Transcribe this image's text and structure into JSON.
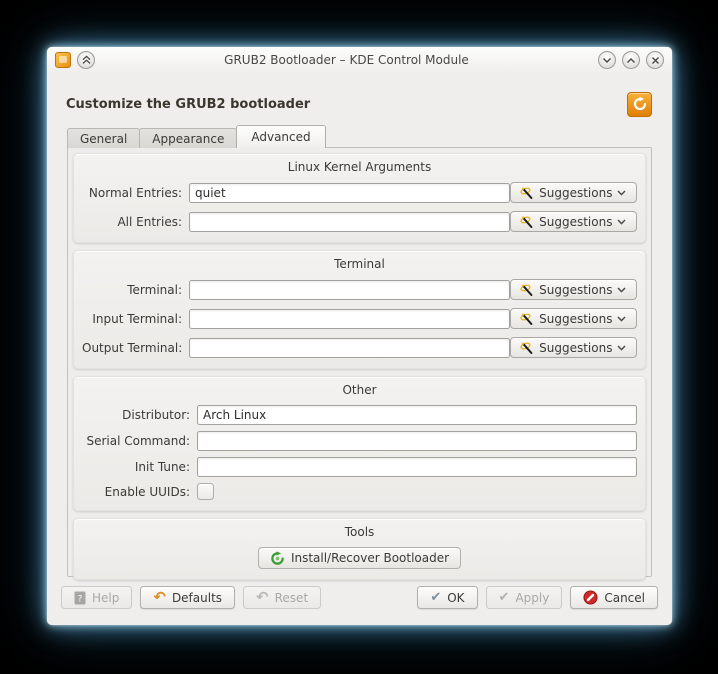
{
  "titlebar": {
    "title": "GRUB2 Bootloader – KDE Control Module"
  },
  "header": {
    "title": "Customize the GRUB2 bootloader"
  },
  "tabs": {
    "general": "General",
    "appearance": "Appearance",
    "advanced": "Advanced"
  },
  "labels": {
    "suggestions": "Suggestions"
  },
  "kernel": {
    "title": "Linux Kernel Arguments",
    "normal_label": "Normal Entries:",
    "normal_value": "quiet",
    "all_label": "All Entries:",
    "all_value": ""
  },
  "terminal": {
    "title": "Terminal",
    "terminal_label": "Terminal:",
    "terminal_value": "",
    "input_label": "Input Terminal:",
    "input_value": "",
    "output_label": "Output Terminal:",
    "output_value": ""
  },
  "other": {
    "title": "Other",
    "distributor_label": "Distributor:",
    "distributor_value": "Arch Linux",
    "serial_label": "Serial Command:",
    "serial_value": "",
    "init_label": "Init Tune:",
    "init_value": "",
    "uuids_label": "Enable UUIDs:",
    "uuids_checked": false
  },
  "tools": {
    "title": "Tools",
    "install_button": "Install/Recover Bootloader"
  },
  "footer": {
    "help": "Help",
    "defaults": "Defaults",
    "reset": "Reset",
    "ok": "OK",
    "apply": "Apply",
    "cancel": "Cancel"
  },
  "colors": {
    "accent_orange": "#e8941a",
    "glow_blue": "#a5d8ee",
    "cancel_red": "#cf2a2a",
    "install_green": "#3a9e33"
  }
}
